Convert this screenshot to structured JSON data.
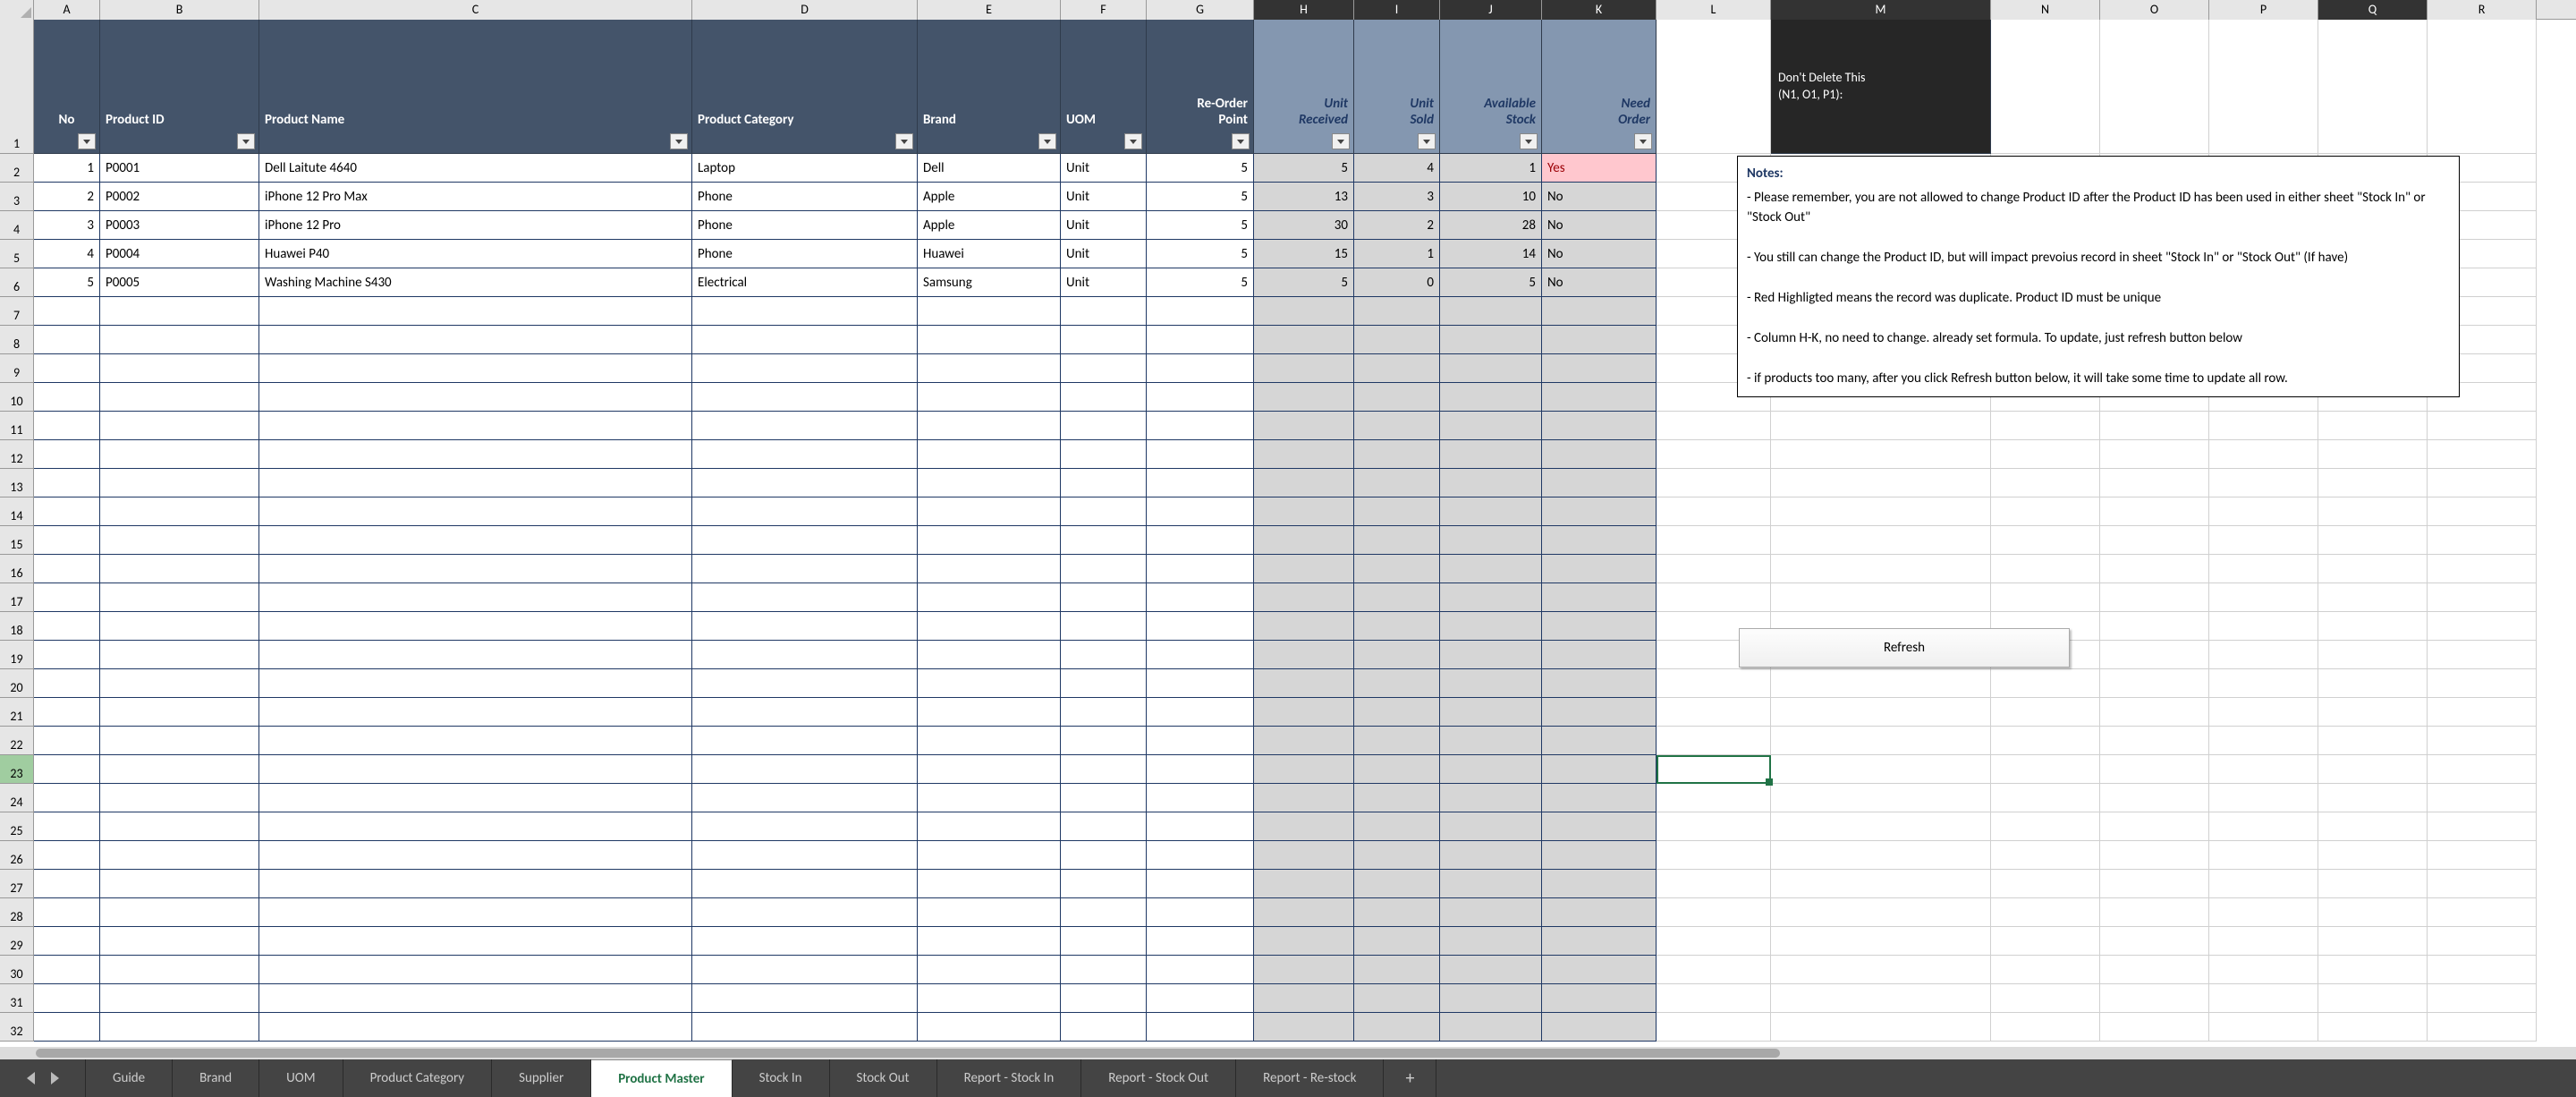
{
  "columns": [
    "A",
    "B",
    "C",
    "D",
    "E",
    "F",
    "G",
    "H",
    "I",
    "J",
    "K",
    "L",
    "M",
    "N",
    "O",
    "P",
    "Q",
    "R"
  ],
  "header": {
    "no": "No",
    "product_id": "Product ID",
    "product_name": "Product Name",
    "product_category": "Product Category",
    "brand": "Brand",
    "uom": "UOM",
    "reorder_line1": "Re-Order",
    "reorder_line2": "Point",
    "unit_recv_line1": "Unit",
    "unit_recv_line2": "Received",
    "unit_sold_line1": "Unit",
    "unit_sold_line2": "Sold",
    "avail_line1": "Available",
    "avail_line2": "Stock",
    "need_line1": "Need",
    "need_line2": "Order",
    "m_line1": "Don't Delete This",
    "m_line2": "(N1, O1, P1):"
  },
  "notes": {
    "title": "Notes:",
    "lines": [
      "- Please remember, you are not allowed to change Product ID after the Product ID has been used in either sheet \"Stock In\" or \"Stock Out\"",
      "- You still can change the Product ID, but will impact prevoius record in sheet \"Stock In\" or \"Stock Out\" (If have)",
      "- Red Highligted means the record was duplicate. Product ID must be unique",
      "- Column H-K, no need to change. already set formula. To update, just refresh button below",
      "- if products too many, after you click Refresh button below, it will take some time to update all row."
    ]
  },
  "refresh_label": "Refresh",
  "rows": [
    {
      "no": "1",
      "pid": "P0001",
      "name": "Dell Laitute 4640",
      "cat": "Laptop",
      "brand": "Dell",
      "uom": "Unit",
      "rop": "5",
      "recv": "5",
      "sold": "4",
      "avail": "1",
      "need": "Yes",
      "need_yes": true
    },
    {
      "no": "2",
      "pid": "P0002",
      "name": "iPhone 12 Pro Max",
      "cat": "Phone",
      "brand": "Apple",
      "uom": "Unit",
      "rop": "5",
      "recv": "13",
      "sold": "3",
      "avail": "10",
      "need": "No"
    },
    {
      "no": "3",
      "pid": "P0003",
      "name": "iPhone 12 Pro",
      "cat": "Phone",
      "brand": "Apple",
      "uom": "Unit",
      "rop": "5",
      "recv": "30",
      "sold": "2",
      "avail": "28",
      "need": "No"
    },
    {
      "no": "4",
      "pid": "P0004",
      "name": "Huawei P40",
      "cat": "Phone",
      "brand": "Huawei",
      "uom": "Unit",
      "rop": "5",
      "recv": "15",
      "sold": "1",
      "avail": "14",
      "need": "No"
    },
    {
      "no": "5",
      "pid": "P0005",
      "name": "Washing Machine S430",
      "cat": "Electrical",
      "brand": "Samsung",
      "uom": "Unit",
      "rop": "5",
      "recv": "5",
      "sold": "0",
      "avail": "5",
      "need": "No"
    }
  ],
  "empty_rows": 26,
  "active_cell": "L23",
  "tabs": [
    "Guide",
    "Brand",
    "UOM",
    "Product Category",
    "Supplier",
    "Product Master",
    "Stock In",
    "Stock Out",
    "Report - Stock In",
    "Report - Stock Out",
    "Report - Re-stock"
  ],
  "active_tab": "Product Master"
}
